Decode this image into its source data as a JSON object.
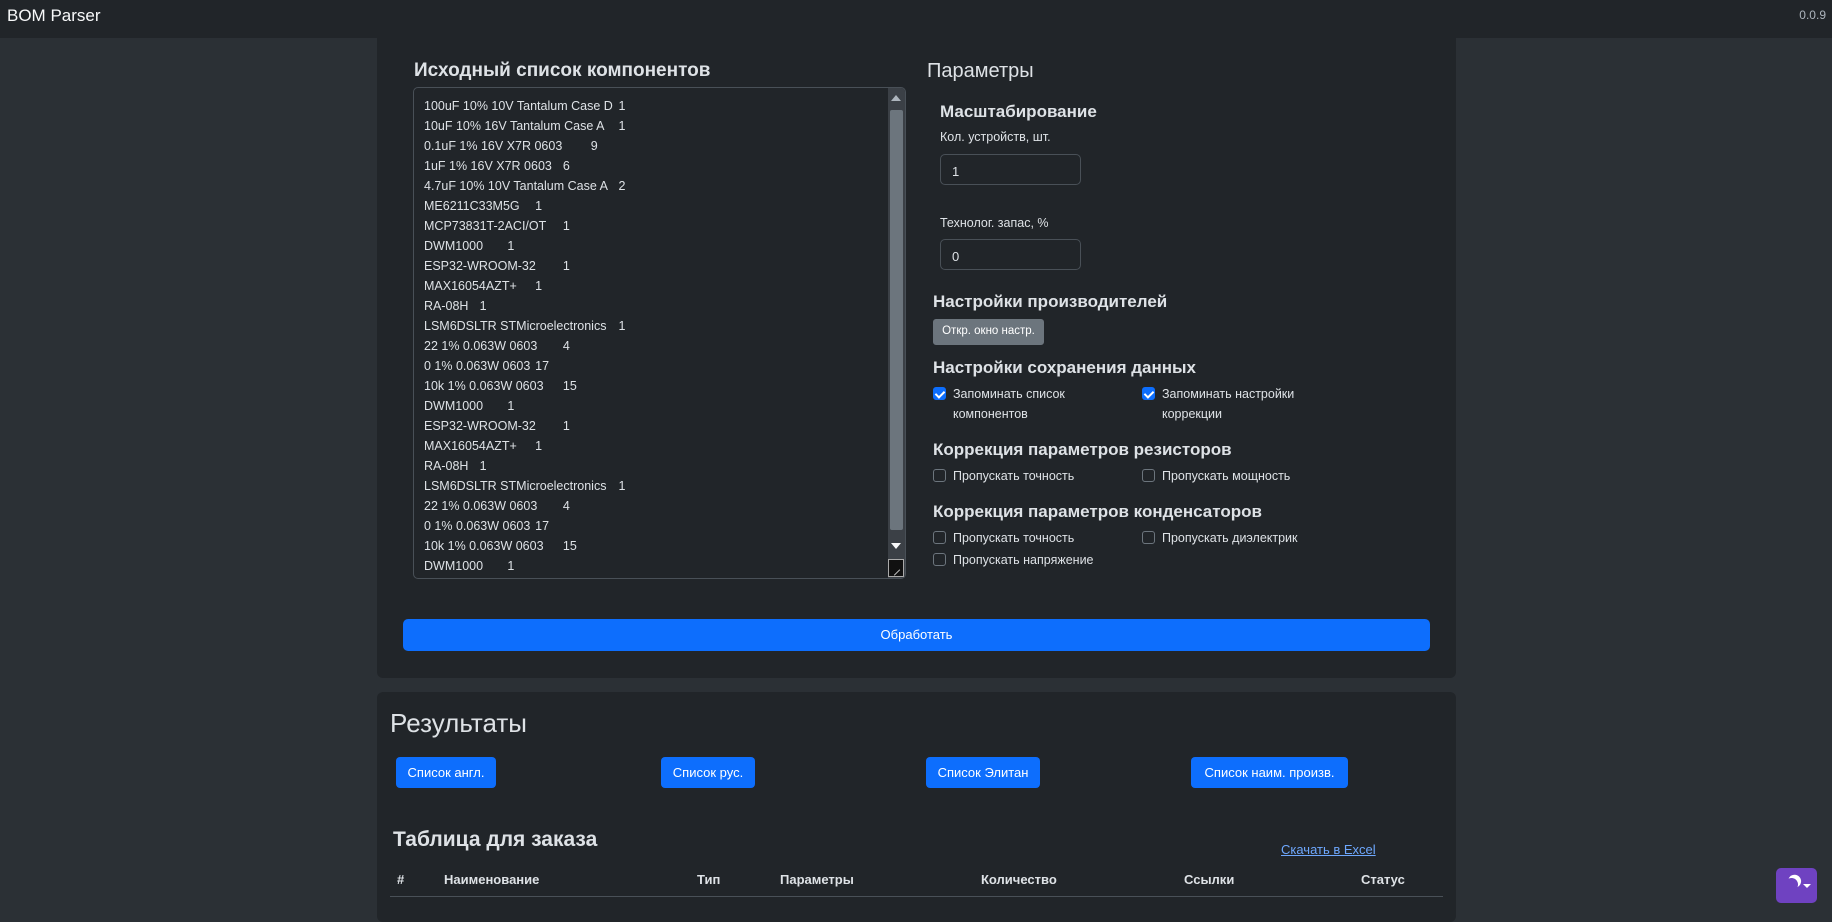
{
  "navbar": {
    "brand": "BOM Parser",
    "version": "0.0.9"
  },
  "source": {
    "title": "Исходный список компонентов",
    "lines": [
      "100uF 10% 10V Tantalum Case D\t1",
      "10uF 10% 16V Tantalum Case A\t1",
      "0.1uF 1% 16V X7R 0603\t9",
      "1uF 1% 16V X7R 0603\t6",
      "4.7uF 10% 10V Tantalum Case A\t2",
      "ME6211C33M5G\t1",
      "MCP73831T-2ACI/OT\t1",
      "DWM1000\t1",
      "ESP32-WROOM-32\t1",
      "MAX16054AZT+\t1",
      "RA-08H\t1",
      "LSM6DSLTR STMicroelectronics\t1",
      "22 1% 0.063W 0603\t4",
      "0 1% 0.063W 0603\t17",
      "10k 1% 0.063W 0603\t15",
      "DWM1000\t1",
      "ESP32-WROOM-32\t1",
      "MAX16054AZT+\t1",
      "RA-08H\t1",
      "LSM6DSLTR STMicroelectronics\t1",
      "22 1% 0.063W 0603\t4",
      "0 1% 0.063W 0603\t17",
      "10k 1% 0.063W 0603\t15",
      "DWM1000\t1"
    ]
  },
  "params": {
    "title": "Параметры",
    "scaling": {
      "title": "Масштабирование",
      "devices_label": "Кол. устройств, шт.",
      "devices_value": "1",
      "reserve_label": "Технолог. запас, %",
      "reserve_value": "0"
    },
    "manufacturers": {
      "title": "Настройки производителей",
      "button": "Откр. окно настр."
    },
    "storage": {
      "title": "Настройки сохранения данных",
      "remember_list": "Запоминать список компонентов",
      "remember_correction": "Запоминать настройки коррекции"
    },
    "resistors": {
      "title": "Коррекция параметров резисторов",
      "skip_tolerance": "Пропускать точность",
      "skip_power": "Пропускать мощность"
    },
    "capacitors": {
      "title": "Коррекция параметров конденсаторов",
      "skip_tolerance": "Пропускать точность",
      "skip_dielectric": "Пропускать диэлектрик",
      "skip_voltage": "Пропускать напряжение"
    }
  },
  "process_button": "Обработать",
  "results": {
    "title": "Результаты",
    "buttons": [
      "Список англ.",
      "Список рус.",
      "Список Элитан",
      "Список наим. произв."
    ]
  },
  "order": {
    "title": "Таблица для заказа",
    "excel_link": "Скачать в Excel",
    "columns": [
      "#",
      "Наименование",
      "Тип",
      "Параметры",
      "Количество",
      "Ссылки",
      "Статус"
    ]
  },
  "theme_toggle": {
    "icon": "moon-icon"
  },
  "colors": {
    "primary": "#0d6efd",
    "secondary": "#6c757d",
    "theme": "#6f42c1",
    "link": "#6ea8fe"
  }
}
